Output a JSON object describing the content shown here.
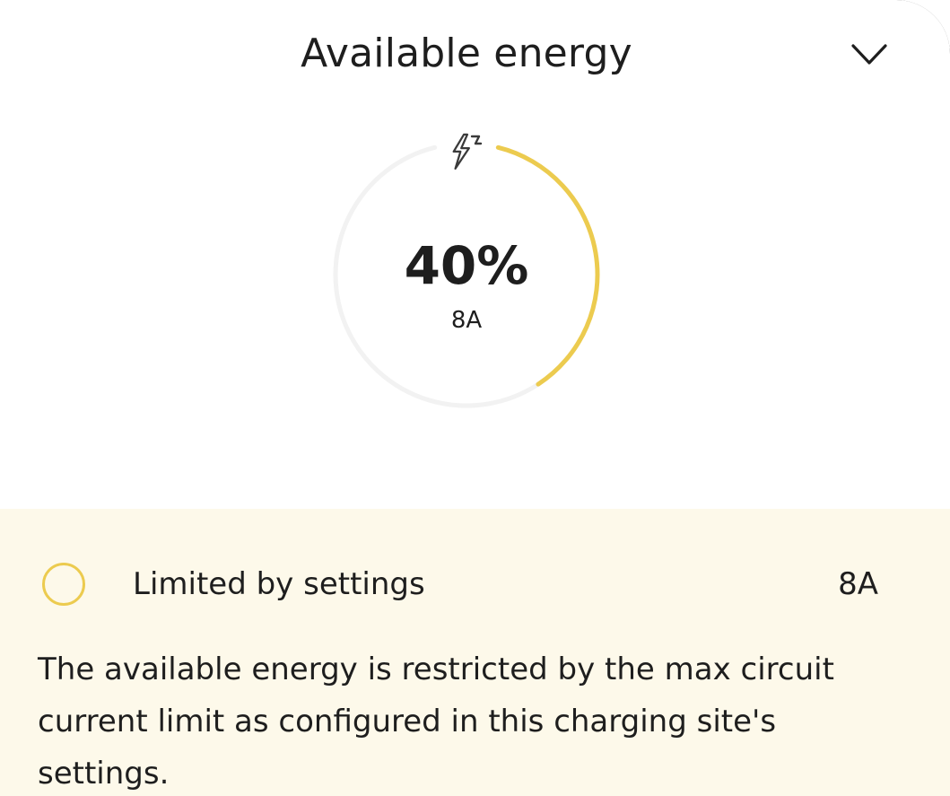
{
  "header": {
    "title": "Available energy",
    "collapse_icon": "chevron-down-icon"
  },
  "gauge": {
    "icon": "lightning-bolt-icon",
    "percent_label": "40%",
    "percent_value": 0.4,
    "current_label": "8A",
    "colors": {
      "fill": "#eccb4f",
      "track": "#f2f2f2"
    }
  },
  "limit": {
    "icon": "ring-indicator-icon",
    "label": "Limited by settings",
    "value": "8A",
    "color": "#eccb4f",
    "background": "#fdf9ea"
  },
  "description": "The available energy is restricted by the max circuit current limit as configured in this charging site's settings."
}
